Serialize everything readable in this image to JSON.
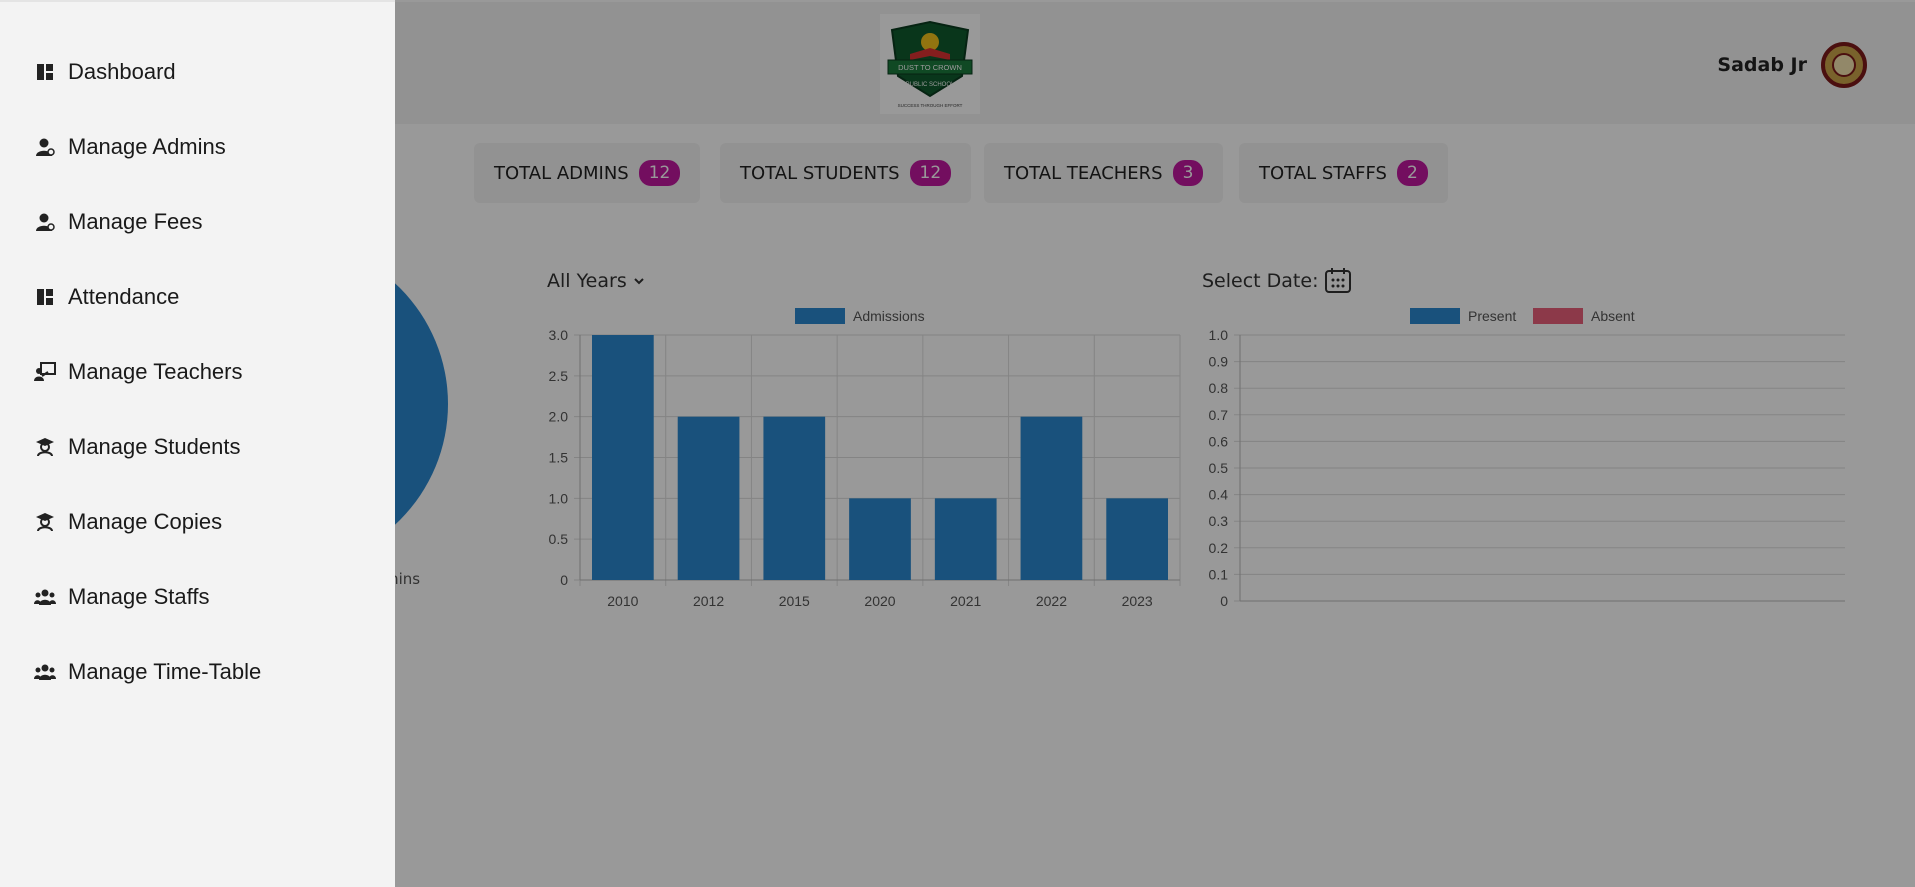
{
  "header": {
    "user_name": "Sadab Jr",
    "logo_text": "DUST TO CROWN",
    "logo_sub": "PUBLIC SCHOOL",
    "logo_motto": "SUCCESS THROUGH EFFORT"
  },
  "stats": [
    {
      "label": "TOTAL ADMINS",
      "count": "12"
    },
    {
      "label": "TOTAL STUDENTS",
      "count": "12"
    },
    {
      "label": "TOTAL TEACHERS",
      "count": "3"
    },
    {
      "label": "TOTAL STAFFS",
      "count": "2"
    }
  ],
  "pie": {
    "label_fragment": "mins"
  },
  "filters": {
    "years_label": "All Years",
    "select_date_label": "Select Date:"
  },
  "sidebar": {
    "items": [
      {
        "label": "Dashboard",
        "icon": "dashboard-icon"
      },
      {
        "label": "Manage Admins",
        "icon": "person-icon"
      },
      {
        "label": "Manage Fees",
        "icon": "person-icon"
      },
      {
        "label": "Attendance",
        "icon": "dashboard-icon"
      },
      {
        "label": "Manage Teachers",
        "icon": "teacher-icon"
      },
      {
        "label": "Manage Students",
        "icon": "student-icon"
      },
      {
        "label": "Manage Copies",
        "icon": "student-icon"
      },
      {
        "label": "Manage Staffs",
        "icon": "group-icon"
      },
      {
        "label": "Manage Time-Table",
        "icon": "group-icon"
      }
    ]
  },
  "colors": {
    "accent_badge": "#c0189f",
    "bar_blue": "#2b87cf",
    "absent_red": "#ea5f7a"
  },
  "chart_data": [
    {
      "type": "bar",
      "categories": [
        "2010",
        "2012",
        "2015",
        "2020",
        "2021",
        "2022",
        "2023"
      ],
      "series": [
        {
          "name": "Admissions",
          "values": [
            3,
            2,
            2,
            1,
            1,
            2,
            1
          ]
        }
      ],
      "yticks": [
        "0",
        "0.5",
        "1.0",
        "1.5",
        "2.0",
        "2.5",
        "3.0"
      ],
      "ylim": [
        0,
        3
      ],
      "legend": "top-center",
      "grid": true
    },
    {
      "type": "bar",
      "categories": [],
      "series": [
        {
          "name": "Present",
          "values": []
        },
        {
          "name": "Absent",
          "values": []
        }
      ],
      "yticks": [
        "0",
        "0.1",
        "0.2",
        "0.3",
        "0.4",
        "0.5",
        "0.6",
        "0.7",
        "0.8",
        "0.9",
        "1.0"
      ],
      "ylim": [
        0,
        1
      ],
      "legend": "top-center",
      "grid": true
    }
  ]
}
